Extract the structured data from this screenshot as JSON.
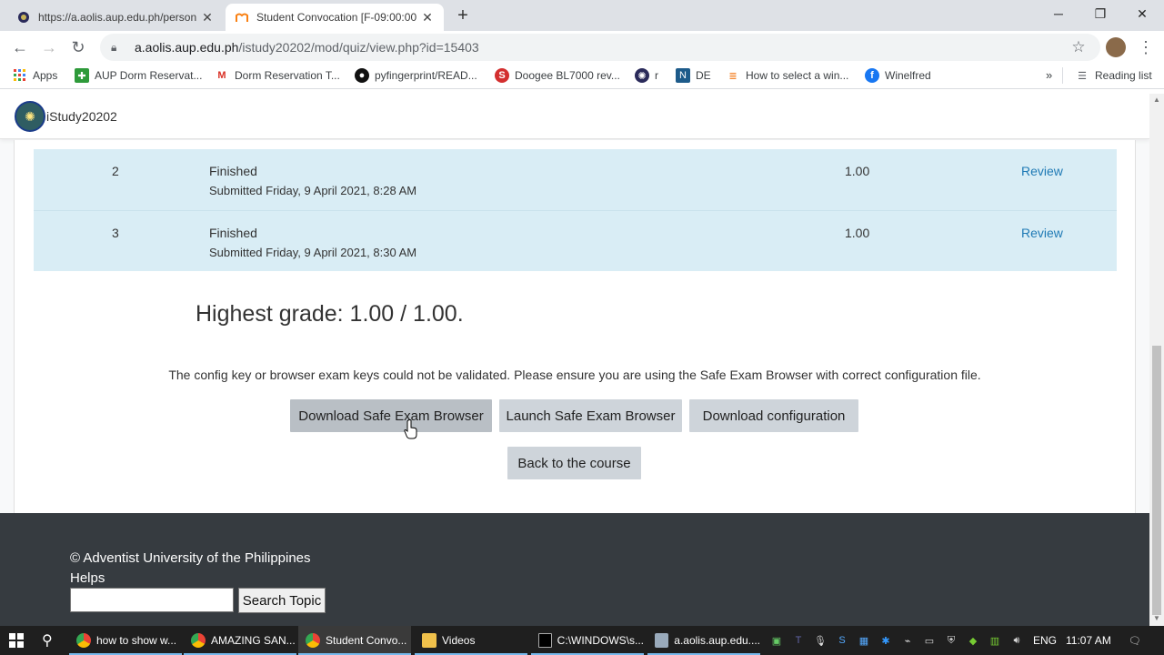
{
  "browser": {
    "tabs": [
      {
        "title": "https://a.aolis.aup.edu.ph/person"
      },
      {
        "title": "Student Convocation [F-09:00:00"
      }
    ],
    "new_tab": "+",
    "url_host": "a.aolis.aup.edu.ph",
    "url_path": "/istudy20202/mod/quiz/view.php?id=15403",
    "bookmarks": [
      {
        "label": "Apps",
        "icon": "apps-grid-icon"
      },
      {
        "label": "AUP Dorm Reservat...",
        "icon": "green-plus-icon"
      },
      {
        "label": "Dorm Reservation T...",
        "icon": "gmail-icon"
      },
      {
        "label": "pyfingerprint/READ...",
        "icon": "github-icon"
      },
      {
        "label": "Doogee BL7000 rev...",
        "icon": "s-red-icon"
      },
      {
        "label": "r",
        "icon": "seal-icon"
      },
      {
        "label": "DE",
        "icon": "de-icon"
      },
      {
        "label": "How to select a win...",
        "icon": "stack-icon"
      },
      {
        "label": "Winelfred",
        "icon": "facebook-icon"
      }
    ],
    "reading_list": "Reading list",
    "more_bookmarks": "»"
  },
  "site": {
    "name": "iStudy20202"
  },
  "attempts": [
    {
      "num": "2",
      "state": "Finished",
      "submitted": "Submitted Friday, 9 April 2021, 8:28 AM",
      "grade": "1.00",
      "action": "Review"
    },
    {
      "num": "3",
      "state": "Finished",
      "submitted": "Submitted Friday, 9 April 2021, 8:30 AM",
      "grade": "1.00",
      "action": "Review"
    }
  ],
  "highest_grade": "Highest grade: 1.00 / 1.00.",
  "warning": "The config key or browser exam keys could not be validated. Please ensure you are using the Safe Exam Browser with correct configuration file.",
  "buttons": {
    "download_seb": "Download Safe Exam Browser",
    "launch_seb": "Launch Safe Exam Browser",
    "download_config": "Download configuration",
    "back": "Back to the course"
  },
  "footer": {
    "copyright": "© Adventist University of the Philippines",
    "helps": "Helps",
    "search_value": "",
    "search_button": "Search Topic"
  },
  "taskbar": {
    "items": [
      {
        "label": "how to show w...",
        "icon": "chrome-icon"
      },
      {
        "label": "AMAZING SAN...",
        "icon": "chrome-icon"
      },
      {
        "label": "Student Convo...",
        "icon": "chrome-icon"
      },
      {
        "label": "Videos",
        "icon": "folder-icon"
      },
      {
        "label": "C:\\WINDOWS\\s...",
        "icon": "cmd-icon"
      },
      {
        "label": "a.aolis.aup.edu....",
        "icon": "pen-icon"
      }
    ],
    "language": "ENG",
    "time": "11:07 AM"
  }
}
